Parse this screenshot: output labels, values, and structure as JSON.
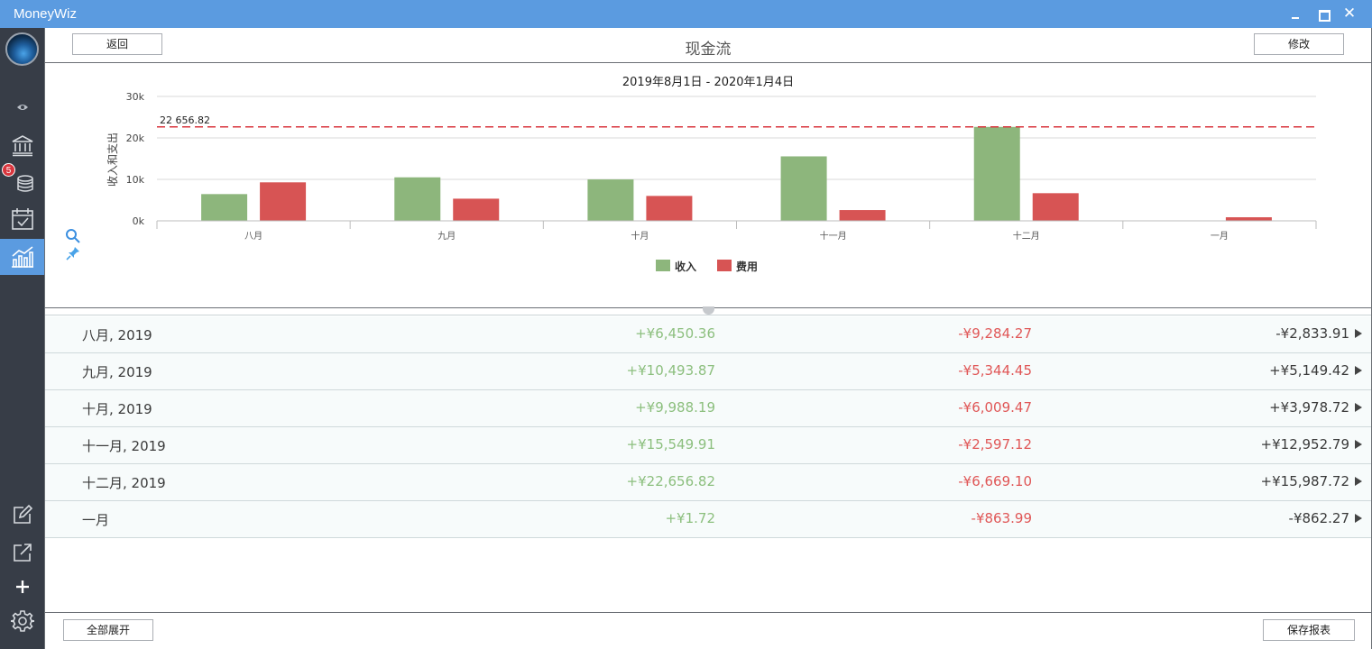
{
  "window": {
    "title": "MoneyWiz",
    "close_glyph": "✕"
  },
  "sidebar": {
    "items": [
      {
        "name": "eye-icon"
      },
      {
        "name": "bank-icon"
      },
      {
        "name": "coins-icon",
        "badge": "5"
      },
      {
        "name": "calendar-check-icon"
      },
      {
        "name": "reports-chart-icon",
        "active": true
      },
      {
        "name": "edit-icon"
      },
      {
        "name": "external-link-icon"
      },
      {
        "name": "plus-icon"
      },
      {
        "name": "gear-icon"
      }
    ]
  },
  "header": {
    "back_label": "返回",
    "title": "现金流",
    "edit_label": "修改"
  },
  "chart_data": {
    "type": "bar",
    "title": "2019年8月1日 - 2020年1月4日",
    "ylabel": "收入和支出",
    "ylim": [
      0,
      30000
    ],
    "ytick_labels": [
      "0k",
      "10k",
      "20k",
      "30k"
    ],
    "yticks": [
      0,
      10000,
      20000,
      30000
    ],
    "categories": [
      "八月",
      "九月",
      "十月",
      "十一月",
      "十二月",
      "一月"
    ],
    "series": [
      {
        "name": "收入",
        "color": "#8db67c",
        "values": [
          6450.36,
          10493.87,
          9988.19,
          15549.91,
          22656.82,
          1.72
        ]
      },
      {
        "name": "费用",
        "color": "#d75454",
        "values": [
          9284.27,
          5344.45,
          6009.47,
          2597.12,
          6669.1,
          863.99
        ]
      }
    ],
    "reference_line": {
      "value": 22656.82,
      "label": "22 656.82",
      "color": "#d9363e"
    },
    "grid": true,
    "legend": "bottom-center"
  },
  "table": {
    "rows": [
      {
        "month": "八月, 2019",
        "income": "+¥6,450.36",
        "expense": "-¥9,284.27",
        "net": "-¥2,833.91"
      },
      {
        "month": "九月, 2019",
        "income": "+¥10,493.87",
        "expense": "-¥5,344.45",
        "net": "+¥5,149.42"
      },
      {
        "month": "十月, 2019",
        "income": "+¥9,988.19",
        "expense": "-¥6,009.47",
        "net": "+¥3,978.72"
      },
      {
        "month": "十一月, 2019",
        "income": "+¥15,549.91",
        "expense": "-¥2,597.12",
        "net": "+¥12,952.79"
      },
      {
        "month": "十二月, 2019",
        "income": "+¥22,656.82",
        "expense": "-¥6,669.10",
        "net": "+¥15,987.72"
      },
      {
        "month": "一月",
        "income": "+¥1.72",
        "expense": "-¥863.99",
        "net": "-¥862.27"
      }
    ]
  },
  "footer": {
    "expand_all_label": "全部展开",
    "save_report_label": "保存报表"
  }
}
